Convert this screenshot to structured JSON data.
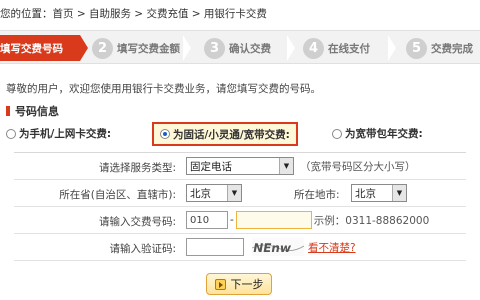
{
  "breadcrumb": "您的位置：首页 > 自助服务 > 交费充值 > 用银行卡交费",
  "steps": [
    {
      "num": "",
      "label": "填写交费号码"
    },
    {
      "num": "2",
      "label": "填写交费金额"
    },
    {
      "num": "3",
      "label": "确认交费"
    },
    {
      "num": "4",
      "label": "在线支付"
    },
    {
      "num": "5",
      "label": "交费完成"
    }
  ],
  "intro": "尊敬的用户，欢迎您使用用银行卡交费业务，请您填写交费的号码。",
  "section_title": "号码信息",
  "radios": [
    {
      "label": "为手机/上网卡交费:",
      "checked": false
    },
    {
      "label": "为固话/小灵通/宽带交费:",
      "checked": true
    },
    {
      "label": "为宽带包年交费:",
      "checked": false
    }
  ],
  "form": {
    "service_type": {
      "label": "请选择服务类型:",
      "value": "固定电话",
      "hint": "（宽带号码区分大小写）"
    },
    "province": {
      "label": "所在省(自治区、直辖市):",
      "value": "北京"
    },
    "city": {
      "label": "所在地市:",
      "value": "北京"
    },
    "number": {
      "label": "请输入交费号码:",
      "area_code": "010",
      "dash": "-",
      "value": "",
      "example": "示例：0311-88862000"
    },
    "captcha": {
      "label": "请输入验证码:",
      "value": "",
      "image_text": "NEnw",
      "refresh": "看不清楚?"
    }
  },
  "next_button": "下一步",
  "colors": {
    "accent": "#d93a1b",
    "highlight": "#fff8d8"
  }
}
